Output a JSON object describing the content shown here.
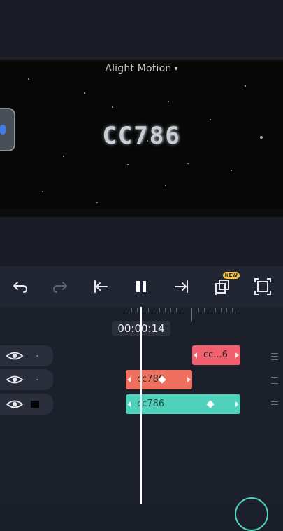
{
  "preview": {
    "watermark": "Alight Motion",
    "watermark_caret": "▾",
    "canvas_text": "CC786"
  },
  "toolbar": {
    "icons": [
      "undo-icon",
      "redo-icon",
      "skip-to-start-icon",
      "pause-icon",
      "skip-to-end-icon",
      "copy-layer-icon",
      "fullscreen-icon"
    ],
    "new_badge": "NEW",
    "accent": "#f6c744"
  },
  "timeline": {
    "timecode": "00:00:14",
    "layers": [
      {
        "clip_label": "cc...6",
        "color": "#f0606e"
      },
      {
        "clip_label": "cc786",
        "color": "#f0705f"
      },
      {
        "clip_label": "cc786",
        "color": "#4fd1bb"
      }
    ]
  }
}
